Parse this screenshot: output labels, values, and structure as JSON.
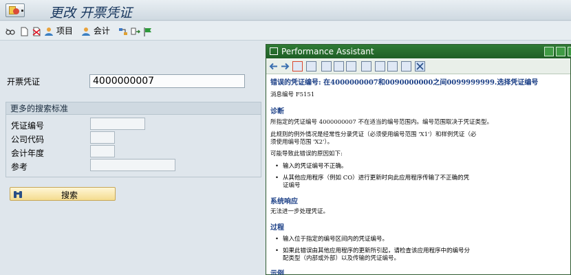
{
  "window": {
    "title": "更改 开票凭证"
  },
  "toolbar": {
    "project_label": "项目",
    "accounting_label": "会计"
  },
  "form": {
    "billing_doc_label": "开票凭证",
    "billing_doc_value": "4000000007",
    "more_criteria_title": "更多的搜索标准",
    "doc_number_label": "凭证编号",
    "company_code_label": "公司代码",
    "fiscal_year_label": "会计年度",
    "reference_label": "参考",
    "search_button_label": "搜索"
  },
  "assistant": {
    "title": "Performance Assistant",
    "error_title": "错误的凭证编号: 在4000000007和0090000000之间0099999999.选择凭证编号",
    "message_number": "消息编号 F5151",
    "diagnosis_heading": "诊断",
    "diagnosis_text": "所指定的凭证编号 4000000007 不在适当的编号范围内。编号范围取决于凭证类型。",
    "exception_line1": "此规则的例外情况是经常性分录凭证（必须使用编号范围 'X1'）和样例凭证（必",
    "exception_line2": "须使用编号范围 'X2'）。",
    "causes_intro": "可能导致此错误的原因如下:",
    "cause1": "输入的凭证编号不正确。",
    "cause2_line1": "从其他应用程序（例如 CO）进行更新时向此应用程序传输了不正确的凭",
    "cause2_line2": "证编号",
    "system_response_heading": "系统响应",
    "system_response_text": "无法进一步处理凭证。",
    "procedure_heading": "过程",
    "step1": "输入位于指定的编号区间内的凭证编号。",
    "step2_line1": "如果此错误由其他应用程序的更新所引起，请检查该应用程序中的编号分",
    "step2_line2": "配类型（内部或外部）以及传输的凭证编号。",
    "example_heading": "示例"
  }
}
